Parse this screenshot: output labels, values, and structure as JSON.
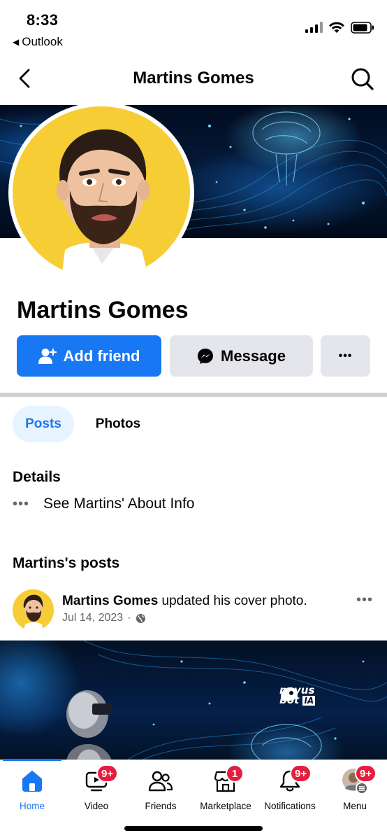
{
  "status_bar": {
    "time": "8:33",
    "back_app": "Outlook",
    "back_arrow_glyph": "◀",
    "icons": [
      "signal-icon",
      "wifi-icon",
      "battery-icon"
    ]
  },
  "header": {
    "title": "Martins Gomes",
    "icons": [
      "back-chevron-icon",
      "search-icon"
    ]
  },
  "profile": {
    "name": "Martins Gomes",
    "actions": {
      "add_friend": "Add friend",
      "message": "Message",
      "more": "•••"
    }
  },
  "tabs": [
    {
      "label": "Posts",
      "active": true
    },
    {
      "label": "Photos",
      "active": false
    }
  ],
  "details": {
    "heading": "Details",
    "dots": "•••",
    "about_link": "See Martins' About Info"
  },
  "posts_section": {
    "heading": "Martins's posts",
    "post": {
      "author": "Martins Gomes",
      "action": " updated his cover photo.",
      "date": "Jul 14, 2023",
      "separator": "·",
      "more": "•••",
      "image_logo_line1": "novus",
      "image_logo_line2": "bot",
      "image_logo_suffix": "IA"
    }
  },
  "bottom_nav": [
    {
      "label": "Home",
      "icon": "home-icon",
      "badge": "",
      "active": true
    },
    {
      "label": "Video",
      "icon": "video-icon",
      "badge": "9+",
      "active": false
    },
    {
      "label": "Friends",
      "icon": "friends-icon",
      "badge": "",
      "active": false
    },
    {
      "label": "Marketplace",
      "icon": "marketplace-icon",
      "badge": "1",
      "active": false
    },
    {
      "label": "Notifications",
      "icon": "bell-icon",
      "badge": "9+",
      "active": false
    },
    {
      "label": "Menu",
      "icon": "menu-avatar-icon",
      "badge": "9+",
      "active": false
    }
  ],
  "colors": {
    "brand_blue": "#1877f2",
    "badge_red": "#e41e3f",
    "button_gray": "#e4e6eb",
    "avatar_yellow": "#f6cd34"
  }
}
